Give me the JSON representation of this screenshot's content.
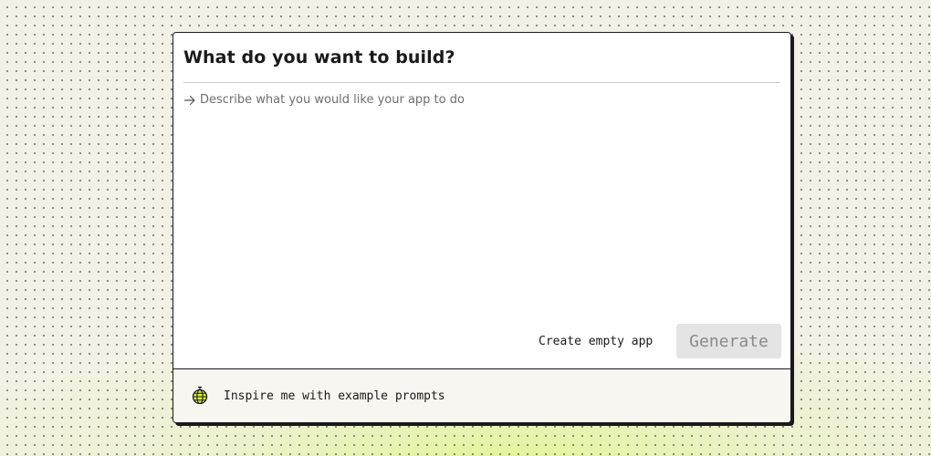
{
  "dialog": {
    "title": "What do you want to build?",
    "prompt": {
      "value": "",
      "placeholder": "Describe what you would like your app to do",
      "icon": "arrow-right-icon"
    },
    "actions": {
      "create_empty_label": "Create empty app",
      "generate_label": "Generate",
      "generate_enabled": false
    },
    "footer": {
      "inspire_label": "Inspire me with example prompts",
      "inspire_icon": "globe-icon"
    }
  },
  "colors": {
    "background": "#f3f1e6",
    "glow": "#e0f596",
    "card": "#ffffff",
    "border": "#1a1a1a",
    "generate_disabled_bg": "#e4e4e4",
    "generate_disabled_text": "#8a8a8a",
    "globe_fill": "#d9f04a"
  }
}
